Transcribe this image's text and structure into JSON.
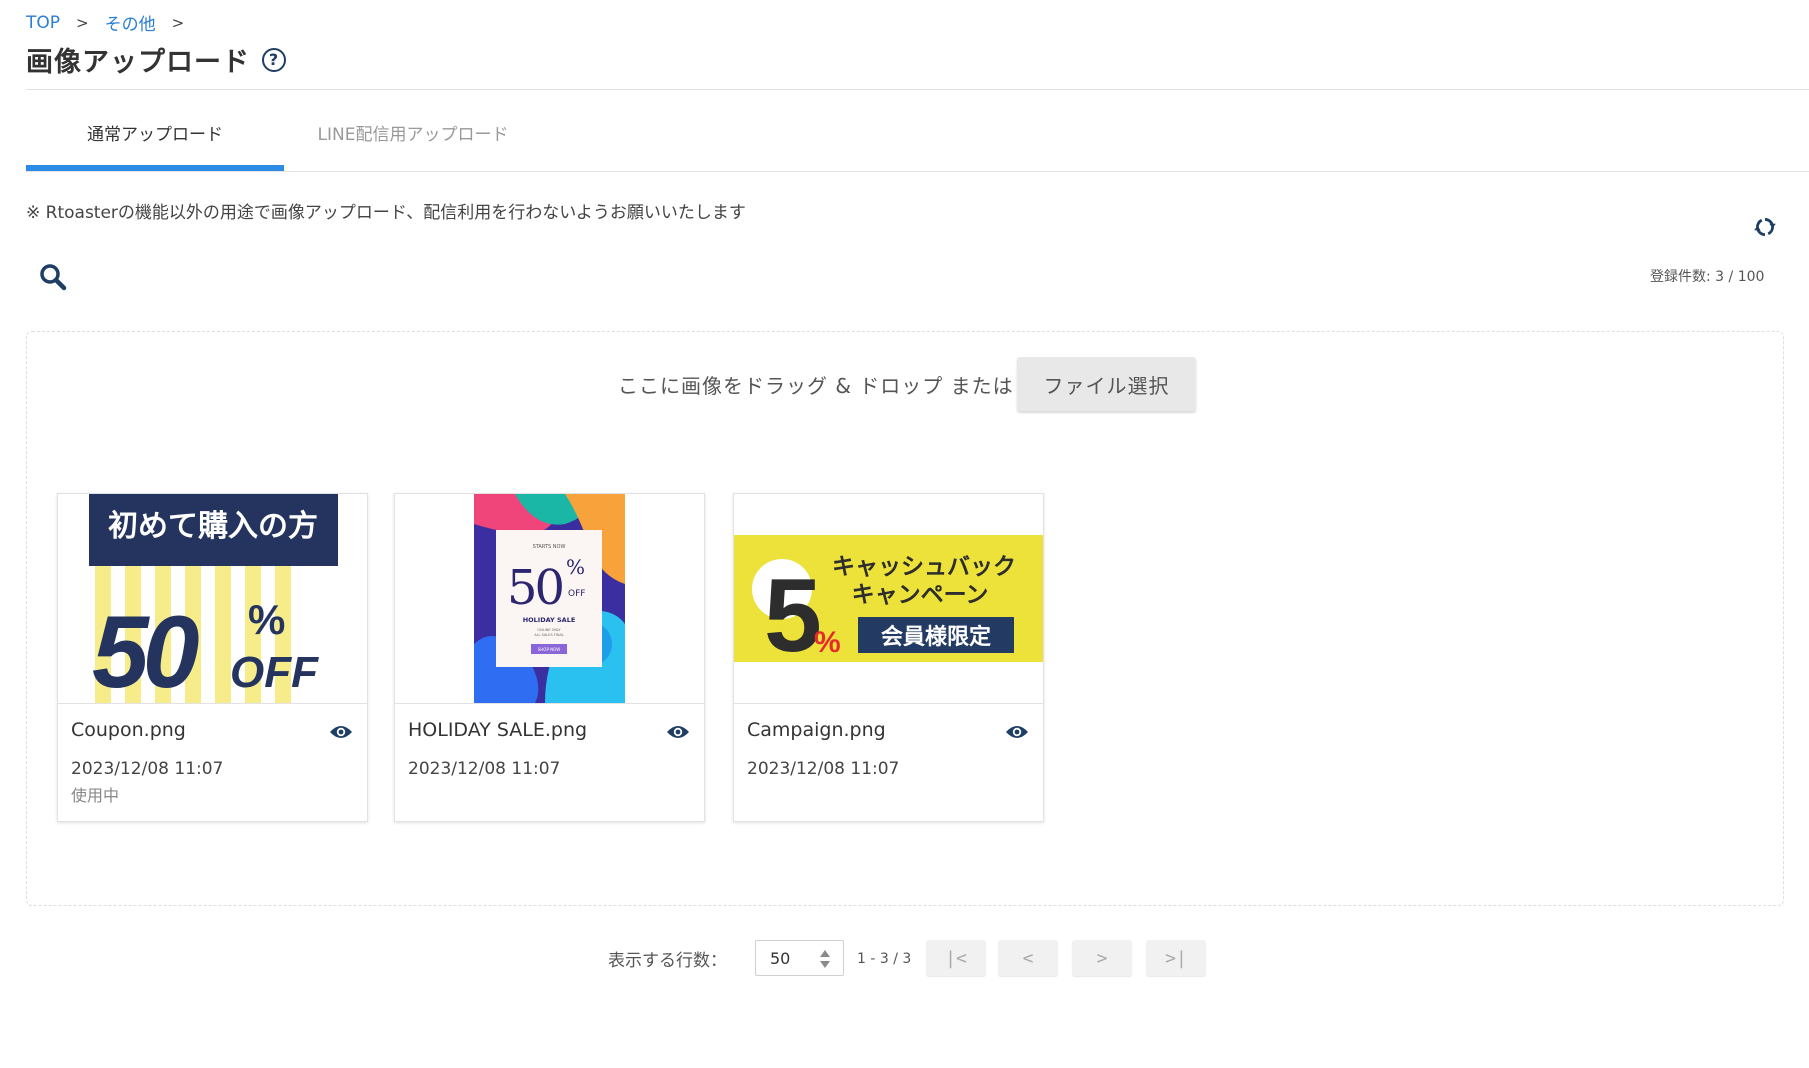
{
  "breadcrumb": {
    "items": [
      "TOP",
      "その他"
    ],
    "separator": ">"
  },
  "page": {
    "title": "画像アップロード",
    "help": "?"
  },
  "tabs": [
    {
      "label": "通常アップロード",
      "active": true
    },
    {
      "label": "LINE配信用アップロード",
      "active": false
    }
  ],
  "notice": "※ Rtoasterの機能以外の用途で画像アップロード、配信利用を行わないようお願いいたします",
  "count_label": "登録件数: 3 / 100",
  "dropzone": {
    "text": "ここに画像をドラッグ & ドロップ または",
    "button": "ファイル選択"
  },
  "cards": [
    {
      "filename": "Coupon.png",
      "date": "2023/12/08 11:07",
      "status": "使用中",
      "thumb": {
        "headline": "初めて購入の方",
        "big": "50",
        "pct": "%",
        "off": "OFF"
      }
    },
    {
      "filename": "HOLIDAY SALE.png",
      "date": "2023/12/08 11:07",
      "status": "",
      "thumb": {
        "top": "STARTS NOW",
        "big": "50",
        "pct": "%",
        "off": "OFF",
        "sale": "HOLIDAY SALE",
        "sub1": "ONLINE ONLY",
        "sub2": "ALL SALES FINAL",
        "cta": "SHOP NOW"
      }
    },
    {
      "filename": "Campaign.png",
      "date": "2023/12/08 11:07",
      "status": "",
      "thumb": {
        "big": "5",
        "pct": "%",
        "line1": "キャッシュバック",
        "line2": "キャンペーン",
        "badge": "会員様限定"
      }
    }
  ],
  "pagination": {
    "rows_label": "表示する行数：",
    "rows_value": "50",
    "range": "1 - 3 / 3",
    "first": "|<",
    "prev": "<",
    "next": ">",
    "last": ">|"
  },
  "colors": {
    "accent": "#2b8be6",
    "link": "#2a7ed4",
    "icon": "#1e3e63"
  }
}
